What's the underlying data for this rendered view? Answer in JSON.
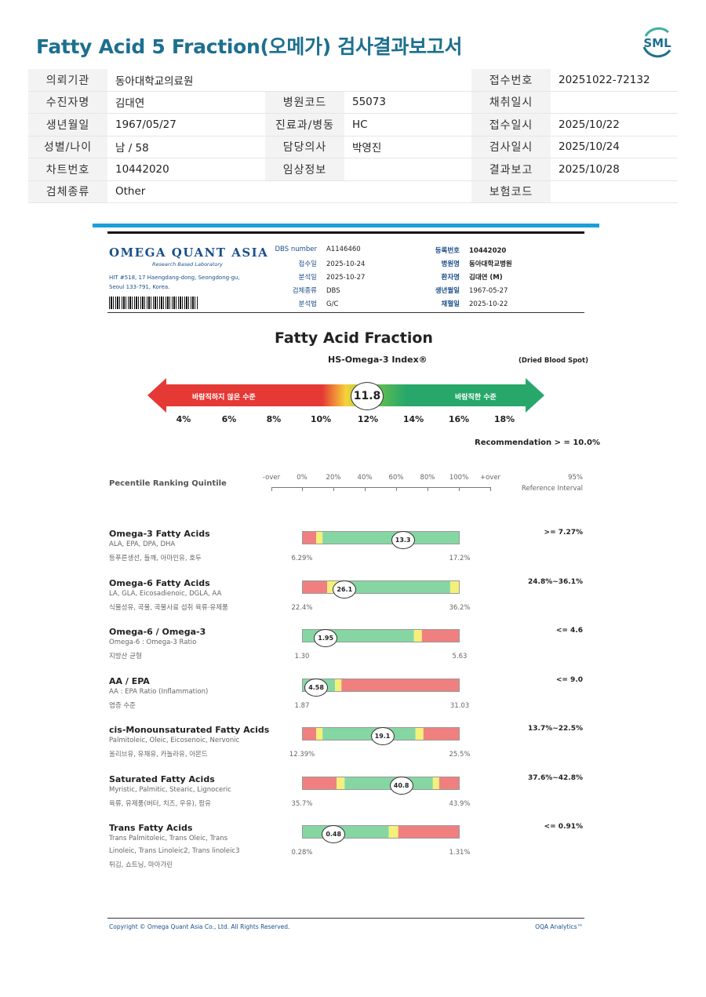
{
  "header": {
    "title": "Fatty Acid 5 Fraction(오메가) 검사결과보고서",
    "logo_text": "SML"
  },
  "info": {
    "rows": [
      [
        {
          "label": "의뢰기관",
          "value": "동아대학교의료원"
        },
        {
          "label": "",
          "value": ""
        },
        {
          "label": "접수번호",
          "value": "20251022-72132"
        }
      ],
      [
        {
          "label": "수진자명",
          "value": "김대연"
        },
        {
          "label": "병원코드",
          "value": "55073"
        },
        {
          "label": "채취일시",
          "value": ""
        }
      ],
      [
        {
          "label": "생년월일",
          "value": "1967/05/27"
        },
        {
          "label": "진료과/병동",
          "value": "HC"
        },
        {
          "label": "접수일시",
          "value": "2025/10/22"
        }
      ],
      [
        {
          "label": "성별/나이",
          "value": "남 / 58"
        },
        {
          "label": "담당의사",
          "value": "박영진"
        },
        {
          "label": "검사일시",
          "value": "2025/10/24"
        }
      ],
      [
        {
          "label": "차트번호",
          "value": "10442020"
        },
        {
          "label": "임상정보",
          "value": ""
        },
        {
          "label": "결과보고",
          "value": "2025/10/28"
        }
      ],
      [
        {
          "label": "검체종류",
          "value": "Other"
        },
        {
          "label": "",
          "value": ""
        },
        {
          "label": "보험코드",
          "value": ""
        }
      ]
    ]
  },
  "lab": {
    "name": "OMEGA QUANT ASIA",
    "sub": "Research Based Laboratory",
    "addr1": "HIT #518, 17 Haengdang-dong, Seongdong-gu,",
    "addr2": "Seoul 133-791, Korea."
  },
  "specimen_left": [
    {
      "k": "DBS number",
      "v": "A1146460"
    },
    {
      "k": "접수일",
      "v": "2025-10-24"
    },
    {
      "k": "분석일",
      "v": "2025-10-27"
    },
    {
      "k": "검체종류",
      "v": "DBS"
    },
    {
      "k": "분석법",
      "v": "G/C"
    }
  ],
  "specimen_right": [
    {
      "k": "등록번호",
      "v": "10442020"
    },
    {
      "k": "병원명",
      "v": "동아대학교병원"
    },
    {
      "k": "환자명",
      "v": "김대연 (M)"
    },
    {
      "k": "생년월일",
      "v": "1967-05-27"
    },
    {
      "k": "채혈일",
      "v": "2025-10-22"
    }
  ],
  "index": {
    "chart_title": "Fatty Acid Fraction",
    "hs_title": "HS-Omega-3 Index®",
    "dbs_note": "(Dried Blood Spot)",
    "bad_label": "바람직하지 않은 수준",
    "good_label": "바람직한 수준",
    "value": "11.8",
    "value_num": 11.8,
    "ticks": [
      "4%",
      "6%",
      "8%",
      "10%",
      "12%",
      "14%",
      "16%",
      "18%"
    ],
    "recommendation": "Recommendation  > = 10.0%"
  },
  "percentile": {
    "title": "Pecentile Ranking Quintile",
    "scale": [
      "-over",
      "0%",
      "20%",
      "40%",
      "60%",
      "80%",
      "100%",
      "+over"
    ],
    "ref_title1": "95%",
    "ref_title2": "Reference Interval"
  },
  "chart_data": {
    "type": "bar",
    "title": "Fatty Acid Fraction",
    "series": [
      {
        "name": "Omega-3 Fatty Acids",
        "sub": [
          "ALA, EPA, DPA, DHA",
          "등푸른생선, 들깨, 아마인유, 호두"
        ],
        "value": "13.3",
        "low": "6.29%",
        "high": "17.2%",
        "ref": ">= 7.27%",
        "pos": 0.64,
        "segments": [
          [
            "#f08080",
            0.09
          ],
          [
            "#f5f07a",
            0.04
          ],
          [
            "#86d6a4",
            0.87
          ]
        ]
      },
      {
        "name": "Omega-6 Fatty Acids",
        "sub": [
          "LA, GLA, Eicosadienoic, DGLA, AA",
          "식물성유, 곡물, 곡물사료 섭취 육류·유제품"
        ],
        "value": "26.1",
        "low": "22.4%",
        "high": "36.2%",
        "ref": "24.8%~36.1%",
        "pos": 0.27,
        "segments": [
          [
            "#f08080",
            0.16
          ],
          [
            "#f5f07a",
            0.07
          ],
          [
            "#86d6a4",
            0.71
          ],
          [
            "#f5f07a",
            0.06
          ]
        ]
      },
      {
        "name": "Omega-6 / Omega-3",
        "sub": [
          "Omega-6 : Omega-3 Ratio",
          "지방산 균형"
        ],
        "value": "1.95",
        "low": "1.30",
        "high": "5.63",
        "ref": "<= 4.6",
        "pos": 0.15,
        "segments": [
          [
            "#86d6a4",
            0.71
          ],
          [
            "#f5f07a",
            0.05
          ],
          [
            "#f08080",
            0.24
          ]
        ]
      },
      {
        "name": "AA / EPA",
        "sub": [
          "AA : EPA Ratio (Inflammation)",
          "염증 수준"
        ],
        "value": "4.58",
        "low": "1.87",
        "high": "31.03",
        "ref": "<= 9.0",
        "pos": 0.09,
        "segments": [
          [
            "#86d6a4",
            0.21
          ],
          [
            "#f5f07a",
            0.04
          ],
          [
            "#f08080",
            0.75
          ]
        ]
      },
      {
        "name": "cis-Monounsaturated Fatty Acids",
        "sub": [
          "Palmitoleic, Oleic, Eicosenoic, Nervonic",
          "올리브유, 유채유, 카놀라유, 아몬드"
        ],
        "value": "19.1",
        "low": "12.39%",
        "high": "25.5%",
        "ref": "13.7%~22.5%",
        "pos": 0.51,
        "segments": [
          [
            "#f08080",
            0.09
          ],
          [
            "#f5f07a",
            0.04
          ],
          [
            "#86d6a4",
            0.59
          ],
          [
            "#f5f07a",
            0.05
          ],
          [
            "#f08080",
            0.23
          ]
        ]
      },
      {
        "name": "Saturated Fatty Acids",
        "sub": [
          "Myristic, Palmitic, Stearic, Lignoceric",
          "육류, 유제품(버터, 치즈, 우유), 팜유"
        ],
        "value": "40.8",
        "low": "35.7%",
        "high": "43.9%",
        "ref": "37.6%~42.8%",
        "pos": 0.63,
        "segments": [
          [
            "#f08080",
            0.22
          ],
          [
            "#f5f07a",
            0.05
          ],
          [
            "#86d6a4",
            0.56
          ],
          [
            "#f5f07a",
            0.04
          ],
          [
            "#f08080",
            0.13
          ]
        ]
      },
      {
        "name": "Trans Fatty Acids",
        "sub": [
          "Trans Palmitoleic, Trans Oleic, Trans",
          "Linoleic, Trans Linoleic2, Trans linoleic3",
          "튀김, 쇼트닝, 마아가린"
        ],
        "value": "0.48",
        "low": "0.28%",
        "high": "1.31%",
        "ref": "<= 0.91%",
        "pos": 0.2,
        "segments": [
          [
            "#86d6a4",
            0.55
          ],
          [
            "#f5f07a",
            0.06
          ],
          [
            "#f08080",
            0.39
          ]
        ]
      }
    ]
  },
  "footer": {
    "left": "Copyright © Omega Quant Asia Co., Ltd.  All Rights Reserved.",
    "right": "OQA Analytics™"
  }
}
